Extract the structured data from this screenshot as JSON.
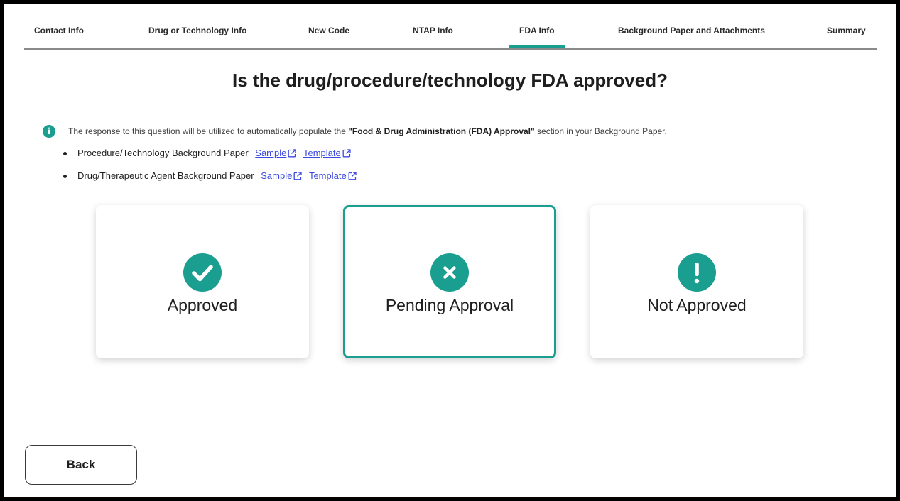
{
  "tabs": [
    {
      "label": "Contact Info"
    },
    {
      "label": "Drug or Technology Info"
    },
    {
      "label": "New Code"
    },
    {
      "label": "NTAP Info"
    },
    {
      "label": "FDA Info",
      "active": true
    },
    {
      "label": "Background Paper and Attachments"
    },
    {
      "label": "Summary"
    }
  ],
  "page_title": "Is the drug/procedure/technology FDA approved?",
  "info": {
    "icon": "info-icon",
    "text_before": "The response to this question will be utilized to automatically populate the ",
    "text_bold": "\"Food & Drug Administration (FDA) Approval\"",
    "text_after": " section in your Background Paper."
  },
  "papers": [
    {
      "label": "Procedure/Technology Background Paper",
      "sample": "Sample",
      "template": "Template"
    },
    {
      "label": "Drug/Therapeutic Agent Background Paper",
      "sample": "Sample",
      "template": "Template"
    }
  ],
  "options": [
    {
      "label": "Approved",
      "icon": "check-icon"
    },
    {
      "label": "Pending Approval",
      "icon": "x-icon",
      "selected": true
    },
    {
      "label": "Not Approved",
      "icon": "exclamation-icon"
    }
  ],
  "back_label": "Back",
  "colors": {
    "accent": "#1a9e8f",
    "link": "#3b49df"
  }
}
